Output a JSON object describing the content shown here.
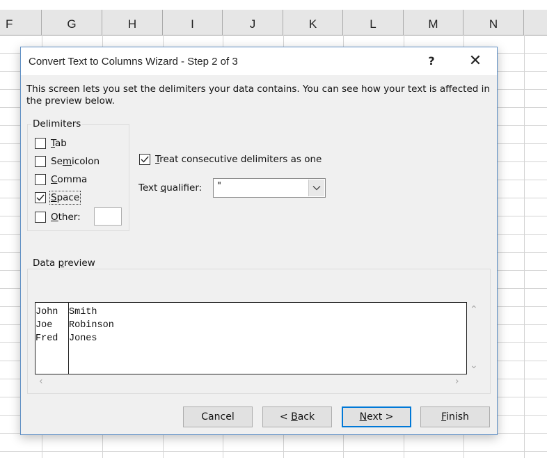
{
  "spreadsheet": {
    "partial_column_left": "F",
    "columns": [
      "G",
      "H",
      "I",
      "J",
      "K",
      "L",
      "M",
      "N"
    ]
  },
  "dialog": {
    "title": "Convert Text to Columns Wizard - Step 2 of 3",
    "help_label": "?",
    "close_label": "✕",
    "description": "This screen lets you set the delimiters your data contains.  You can see how your text is affected in the preview below.",
    "delimiters": {
      "label": "Delimiters",
      "items": [
        {
          "pre": "",
          "key": "T",
          "post": "ab",
          "checked": false
        },
        {
          "pre": "Se",
          "key": "m",
          "post": "icolon",
          "checked": false
        },
        {
          "pre": "",
          "key": "C",
          "post": "omma",
          "checked": false
        },
        {
          "pre": "",
          "key": "S",
          "post": "pace",
          "checked": true
        },
        {
          "pre": "",
          "key": "O",
          "post": "ther:",
          "checked": false
        }
      ],
      "other_value": ""
    },
    "consecutive": {
      "pre": "",
      "key": "T",
      "post": "reat consecutive delimiters as one",
      "checked": true
    },
    "qualifier": {
      "pre": "Text ",
      "key": "q",
      "post": "ualifier:",
      "value": "\""
    },
    "preview": {
      "label_pre": "Data ",
      "label_key": "p",
      "label_post": "review",
      "rows": [
        [
          "John",
          "Smith"
        ],
        [
          "Joe",
          "Robinson"
        ],
        [
          "Fred",
          "Jones"
        ]
      ]
    },
    "buttons": {
      "cancel": "Cancel",
      "back_pre": "< ",
      "back_key": "B",
      "back_post": "ack",
      "next_key": "N",
      "next_post": "ext >",
      "finish_key": "F",
      "finish_post": "inish"
    }
  }
}
